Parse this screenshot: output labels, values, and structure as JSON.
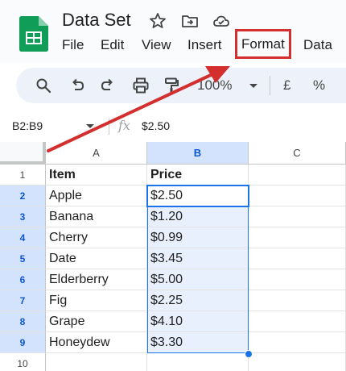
{
  "app": {
    "title": "Data Set",
    "icons": [
      "sheets-logo",
      "star-icon",
      "move-to-folder-icon",
      "cloud-status-icon"
    ]
  },
  "menu": {
    "items": [
      "File",
      "Edit",
      "View",
      "Insert",
      "Format",
      "Data"
    ],
    "highlighted": "Format",
    "highlight_color": "#d32f2f"
  },
  "toolbar": {
    "zoom": "100%",
    "currency": "£",
    "percent": "%",
    "icons": [
      "search-icon",
      "undo-icon",
      "redo-icon",
      "print-icon",
      "paint-format-icon",
      "chevron-down-icon"
    ]
  },
  "formula_bar": {
    "name_box": "B2:B9",
    "fx": "fx",
    "value": "$2.50"
  },
  "sheet": {
    "columns": [
      "A",
      "B",
      "C"
    ],
    "selected_column": "B",
    "row_numbers": [
      "1",
      "2",
      "3",
      "4",
      "5",
      "6",
      "7",
      "8",
      "9",
      "10"
    ],
    "rows": [
      {
        "a": "Item",
        "b": "Price"
      },
      {
        "a": "Apple",
        "b": "$2.50"
      },
      {
        "a": "Banana",
        "b": "$1.20"
      },
      {
        "a": "Cherry",
        "b": "$0.99"
      },
      {
        "a": "Date",
        "b": "$3.45"
      },
      {
        "a": "Elderberry",
        "b": "$5.00"
      },
      {
        "a": "Fig",
        "b": "$2.25"
      },
      {
        "a": "Grape",
        "b": "$4.10"
      },
      {
        "a": "Honeydew",
        "b": "$3.30"
      },
      {
        "a": "",
        "b": ""
      }
    ],
    "selection_color": "#1a73e8"
  }
}
